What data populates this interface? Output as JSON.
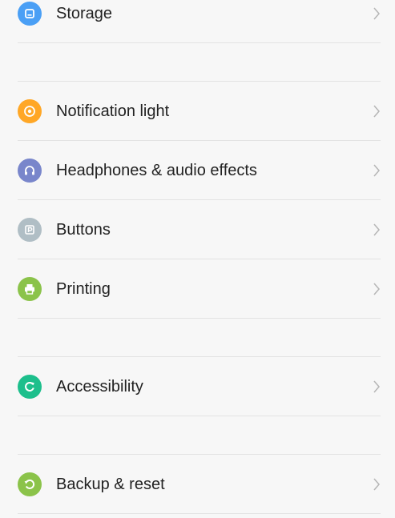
{
  "settings": {
    "items": [
      {
        "label": "Storage",
        "icon": "storage-icon",
        "color": "#4a9ff5"
      },
      {
        "label": "Notification light",
        "icon": "notification-light-icon",
        "color": "#ffa726"
      },
      {
        "label": "Headphones & audio effects",
        "icon": "headphones-icon",
        "color": "#7986cb"
      },
      {
        "label": "Buttons",
        "icon": "buttons-icon",
        "color": "#b0bec5"
      },
      {
        "label": "Printing",
        "icon": "printer-icon",
        "color": "#8bc34a"
      },
      {
        "label": "Accessibility",
        "icon": "accessibility-icon",
        "color": "#1dbf8c"
      },
      {
        "label": "Backup & reset",
        "icon": "backup-icon",
        "color": "#8bc34a"
      }
    ]
  }
}
